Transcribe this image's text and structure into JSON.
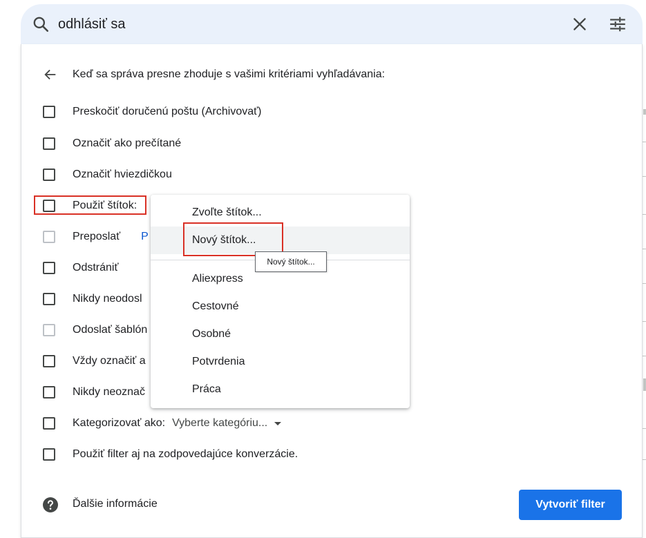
{
  "search": {
    "query": "odhlásiť sa"
  },
  "panel": {
    "header": "Keď sa správa presne zhoduje s vašimi kritériami vyhľadávania:",
    "actions": [
      {
        "label": "Preskočiť doručenú poštu (Archivovať)",
        "disabled": false
      },
      {
        "label": "Označiť ako prečítané",
        "disabled": false
      },
      {
        "label": "Označiť hviezdičkou",
        "disabled": false
      },
      {
        "label": "Použiť štítok:",
        "disabled": false
      },
      {
        "label": "Preposlať",
        "disabled": true,
        "extra": "P"
      },
      {
        "label": "Odstrániť",
        "disabled": false
      },
      {
        "label": "Nikdy neodosl",
        "disabled": false
      },
      {
        "label": "Odoslať šablón",
        "disabled": true
      },
      {
        "label": "Vždy označiť a",
        "disabled": false
      },
      {
        "label": "Nikdy neoznač",
        "disabled": false
      },
      {
        "label": "Kategorizovať ako:",
        "disabled": false,
        "select": "Vyberte kategóriu..."
      },
      {
        "label": "Použiť filter aj na zodpovedajúce konverzácie.",
        "disabled": false
      }
    ],
    "help_label": "Ďalšie informácie",
    "create_button": "Vytvoriť filter"
  },
  "dropdown": {
    "choose_label": "Zvoľte štítok...",
    "new_label": "Nový štítok...",
    "labels": [
      "Aliexpress",
      "Cestovné",
      "Osobné",
      "Potvrdenia",
      "Práca"
    ]
  },
  "tooltip": {
    "text": "Nový štítok..."
  },
  "colors": {
    "search_bg": "#eaf1fb",
    "button_blue": "#1a73e8",
    "highlight_red": "#d93025",
    "link_blue": "#0b57d0"
  }
}
